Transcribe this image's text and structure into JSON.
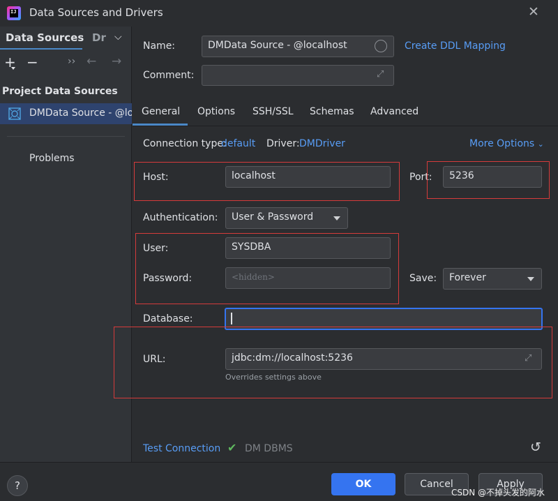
{
  "window": {
    "title": "Data Sources and Drivers",
    "app_icon_text": "IJ"
  },
  "sidebar": {
    "tab_data_sources": "Data Sources",
    "tab_drivers": "Drivers",
    "group_label": "Project Data Sources",
    "selected_item_label": "DMData Source - @localhost",
    "problems_label": "Problems"
  },
  "form": {
    "name_label": "Name:",
    "name_value": "DMData Source - @localhost",
    "create_ddl_link": "Create DDL Mapping",
    "comment_label": "Comment:",
    "comment_value": "",
    "tabs": [
      "General",
      "Options",
      "SSH/SSL",
      "Schemas",
      "Advanced"
    ],
    "active_tab": "General",
    "connection_type_label": "Connection type:",
    "connection_type_value": "default",
    "driver_label": "Driver:",
    "driver_value": "DMDriver",
    "more_options": "More Options",
    "host_label": "Host:",
    "host_value": "localhost",
    "port_label": "Port:",
    "port_value": "5236",
    "auth_label": "Authentication:",
    "auth_value": "User & Password",
    "user_label": "User:",
    "user_value": "SYSDBA",
    "password_label": "Password:",
    "password_placeholder": "<hidden>",
    "save_label": "Save:",
    "save_value": "Forever",
    "database_label": "Database:",
    "database_value": "",
    "url_label": "URL:",
    "url_value": "jdbc:dm://localhost:5236",
    "url_hint": "Overrides settings above"
  },
  "footer": {
    "test_connection": "Test Connection",
    "dbms_name": "DM DBMS",
    "help": "?",
    "ok": "OK",
    "cancel": "Cancel",
    "apply": "Apply"
  },
  "watermark": "CSDN @不掉头发的阿水",
  "colors": {
    "accent": "#3574f0",
    "link": "#589df6",
    "highlight_box": "#d63b3b",
    "selection": "#2e436e",
    "success_check": "#5fb85f"
  }
}
